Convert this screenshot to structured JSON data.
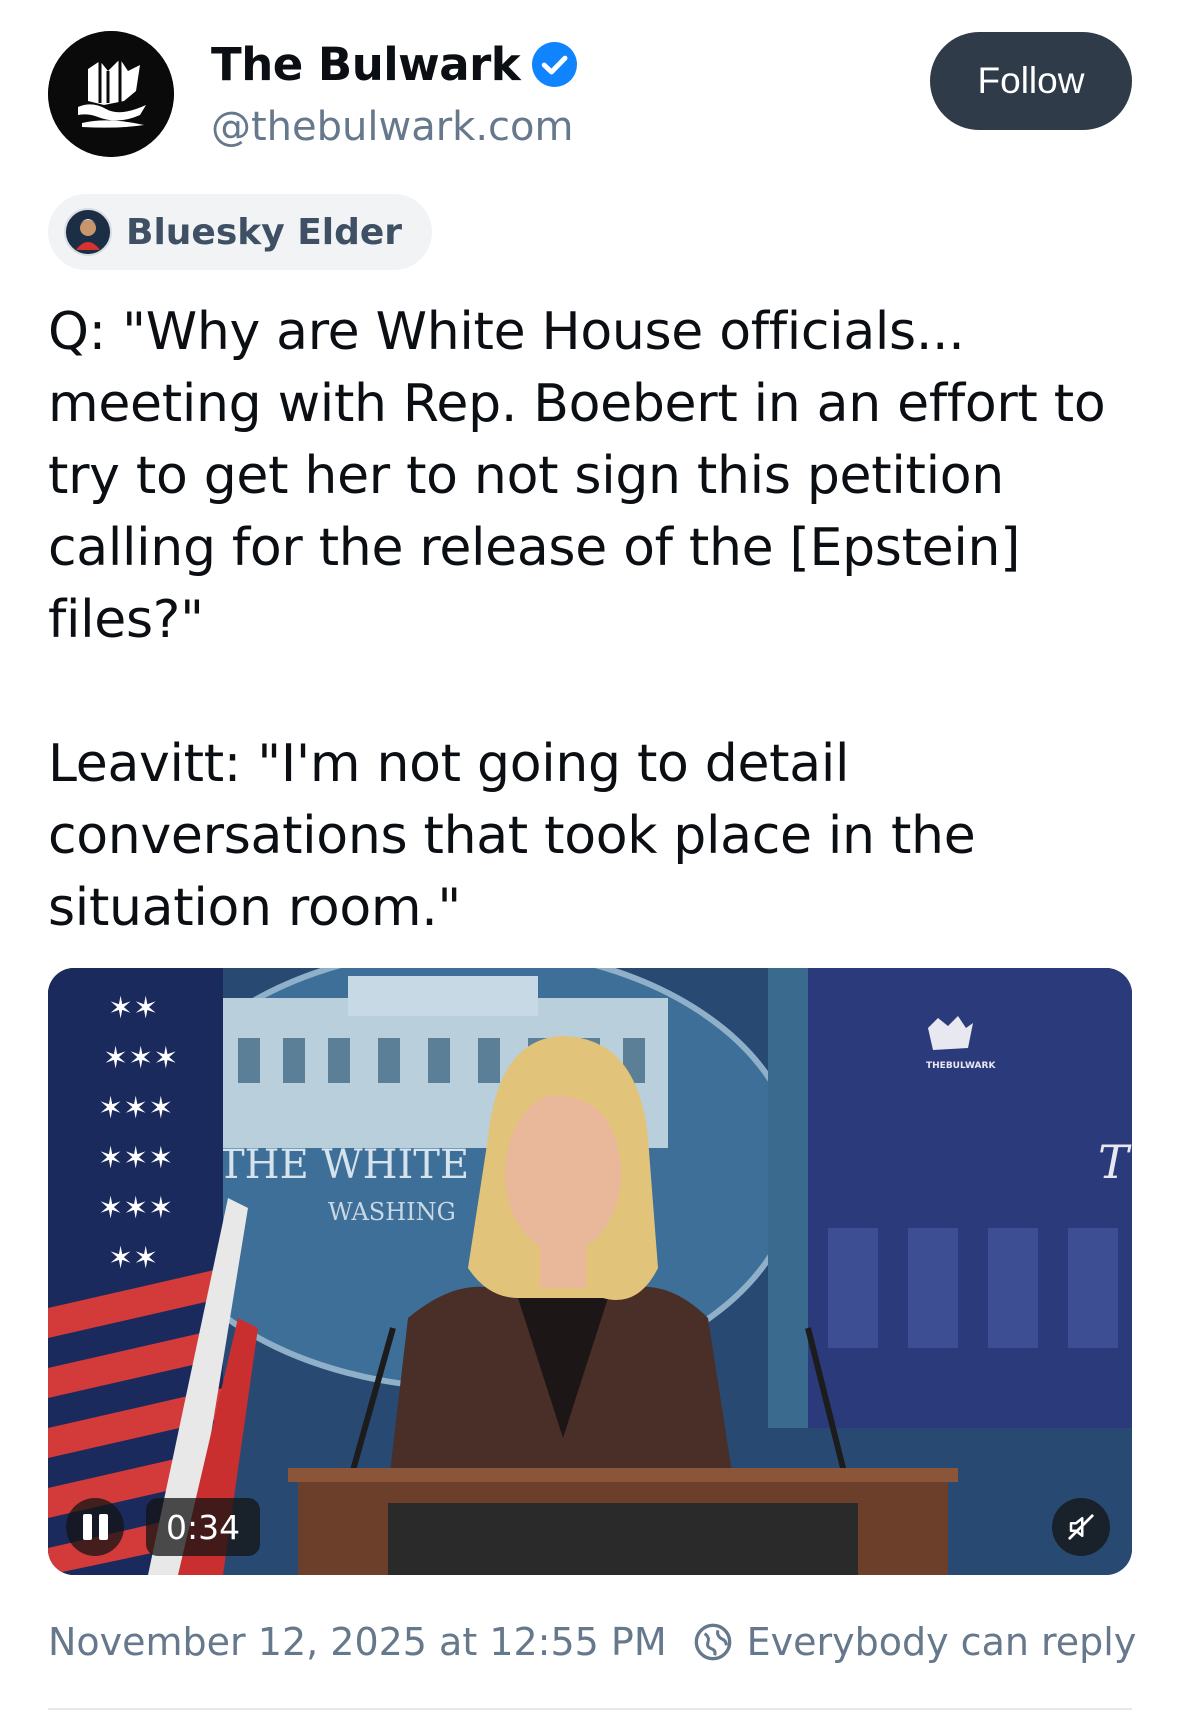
{
  "author": {
    "display_name": "The Bulwark",
    "handle": "@thebulwark.com",
    "avatar_icon": "ship-logo-icon",
    "verified_icon": "verified-check-icon"
  },
  "follow_button": {
    "label": "Follow"
  },
  "badge": {
    "label": "Bluesky Elder",
    "icon": "badge-avatar-icon"
  },
  "post": {
    "text": "Q: \"Why are White House officials... meeting with Rep. Boebert in an effort to try to get her to not sign this petition calling for the release of the [Epstein] files?\"\n\nLeavitt: \"I'm not going to detail conversations that took place in the situation room.\""
  },
  "video": {
    "time": "0:34",
    "backdrop_text_1": "THE WHITE",
    "backdrop_text_2": "WASHING",
    "watermark": "THEBULWARK",
    "screen_letter": "T",
    "pause_icon": "pause-icon",
    "mute_icon": "muted-speaker-icon"
  },
  "meta": {
    "timestamp": "November 12, 2025 at 12:55 PM",
    "reply_setting": "Everybody can reply",
    "reply_icon": "globe-icon"
  },
  "colors": {
    "follow_bg": "#2f3b48",
    "verified_blue": "#1083fe",
    "muted_text": "#66788c",
    "badge_bg": "#f1f3f5"
  }
}
